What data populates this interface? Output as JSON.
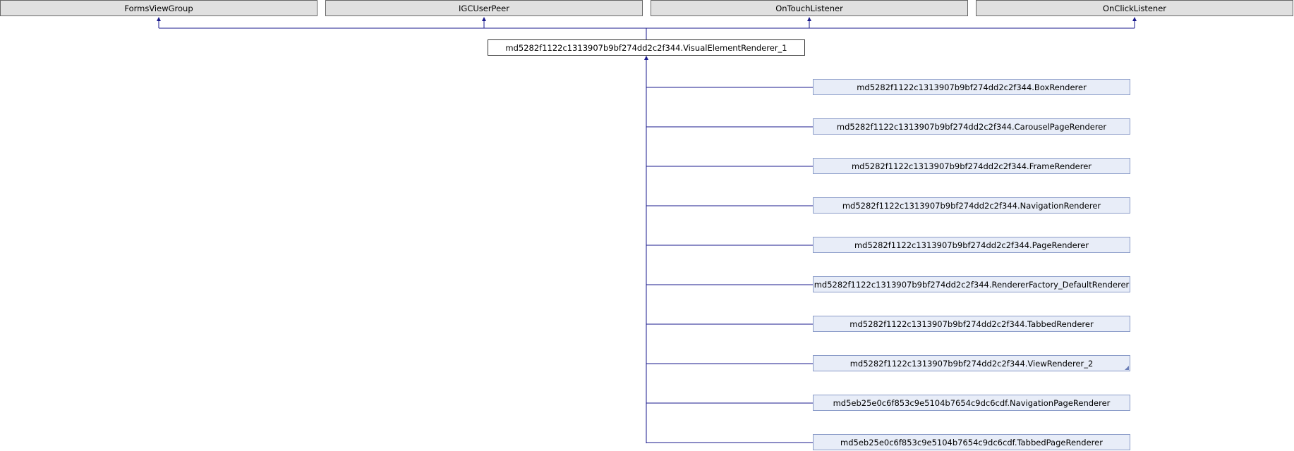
{
  "interfaces": [
    {
      "label": "FormsViewGroup"
    },
    {
      "label": "IGCUserPeer"
    },
    {
      "label": "OnTouchListener"
    },
    {
      "label": "OnClickListener"
    }
  ],
  "base_class": {
    "label": "md5282f1122c1313907b9bf274dd2c2f344.VisualElementRenderer_1"
  },
  "derived_classes": [
    {
      "label": "md5282f1122c1313907b9bf274dd2c2f344.BoxRenderer"
    },
    {
      "label": "md5282f1122c1313907b9bf274dd2c2f344.CarouselPageRenderer"
    },
    {
      "label": "md5282f1122c1313907b9bf274dd2c2f344.FrameRenderer"
    },
    {
      "label": "md5282f1122c1313907b9bf274dd2c2f344.NavigationRenderer"
    },
    {
      "label": "md5282f1122c1313907b9bf274dd2c2f344.PageRenderer"
    },
    {
      "label": "md5282f1122c1313907b9bf274dd2c2f344.RendererFactory_DefaultRenderer"
    },
    {
      "label": "md5282f1122c1313907b9bf274dd2c2f344.TabbedRenderer"
    },
    {
      "label": "md5282f1122c1313907b9bf274dd2c2f344.ViewRenderer_2"
    },
    {
      "label": "md5eb25e0c6f853c9e5104b7654c9dc6cdf.NavigationPageRenderer"
    },
    {
      "label": "md5eb25e0c6f853c9e5104b7654c9dc6cdf.TabbedPageRenderer"
    }
  ],
  "colors": {
    "edge": "#1a1a8c"
  }
}
